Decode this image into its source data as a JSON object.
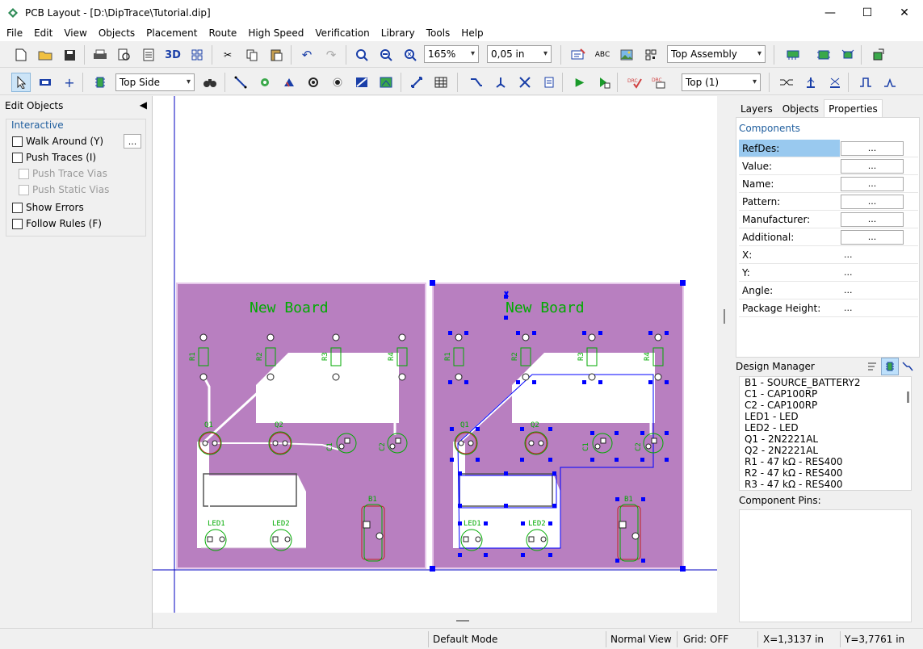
{
  "window": {
    "title": "PCB Layout - [D:\\DipTrace\\Tutorial.dip]",
    "minimize_icon": "minimize-icon",
    "maximize_icon": "maximize-icon",
    "close_icon": "close-icon"
  },
  "menu": [
    "File",
    "Edit",
    "View",
    "Objects",
    "Placement",
    "Route",
    "High Speed",
    "Verification",
    "Library",
    "Tools",
    "Help"
  ],
  "toolbar1": {
    "zoom_value": "165%",
    "grid_value": "0,05 in",
    "btn_3d": "3D",
    "assembly_value": "Top Assembly"
  },
  "toolbar2": {
    "side_value": "Top Side",
    "layer_value": "Top (1)"
  },
  "left_panel": {
    "title": "Edit Objects",
    "group": "Interactive",
    "walk_around": "Walk Around (Y)",
    "more_button": "...",
    "push_traces": "Push Traces (I)",
    "push_trace_vias": "Push Trace Vias",
    "push_static_vias": "Push Static Vias",
    "show_errors": "Show Errors",
    "follow_rules": "Follow Rules (F)"
  },
  "canvas": {
    "board_label_left": "New Board",
    "board_label_right": "New Board",
    "board_fill": "#b87fc0",
    "trace_color": "#ffffff",
    "silk_color": "#00aa00",
    "select_color": "#0000ff",
    "labels": {
      "r1": "R1",
      "r2": "R2",
      "r3": "R3",
      "r4": "R4",
      "q1": "Q1",
      "q2": "Q2",
      "c1": "C1",
      "c2": "C2",
      "led1": "LED1",
      "led2": "LED2",
      "b1": "B1"
    }
  },
  "right_panel": {
    "tabs": [
      "Layers",
      "Objects",
      "Properties"
    ],
    "active_tab": "Properties",
    "section": "Components",
    "properties": [
      {
        "label": "RefDes:",
        "value": "...",
        "button": true,
        "selected": true
      },
      {
        "label": "Value:",
        "value": "...",
        "button": true
      },
      {
        "label": "Name:",
        "value": "...",
        "button": true
      },
      {
        "label": "Pattern:",
        "value": "...",
        "button": true
      },
      {
        "label": "Manufacturer:",
        "value": "...",
        "button": true
      },
      {
        "label": "Additional:",
        "value": "...",
        "button": true
      },
      {
        "label": "X:",
        "value": "...",
        "button": false
      },
      {
        "label": "Y:",
        "value": "...",
        "button": false
      },
      {
        "label": "Angle:",
        "value": "...",
        "button": false
      },
      {
        "label": "Package Height:",
        "value": "...",
        "button": false
      }
    ],
    "design_manager_title": "Design Manager",
    "design_manager_items": [
      "B1 - SOURCE_BATTERY2",
      "C1 - CAP100RP",
      "C2 - CAP100RP",
      "LED1 - LED",
      "LED2 - LED",
      "Q1 - 2N2221AL",
      "Q2 - 2N2221AL",
      "R1 - 47 kΩ - RES400",
      "R2 - 47 kΩ - RES400",
      "R3 - 47 kΩ - RES400"
    ],
    "component_pins_title": "Component Pins:"
  },
  "status": {
    "mode": "Default Mode",
    "view": "Normal View",
    "grid": "Grid: OFF",
    "x": "X=1,3137 in",
    "y": "Y=3,7761 in"
  }
}
